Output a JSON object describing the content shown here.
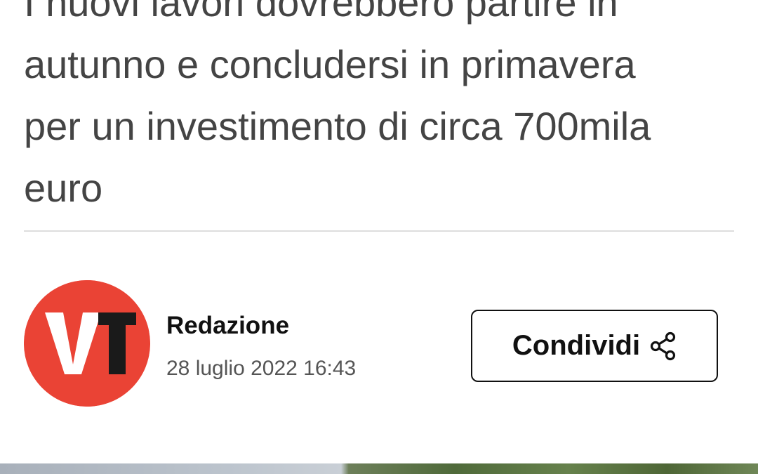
{
  "article": {
    "subtitle_lines": [
      "I nuovi lavori dovrebbero partire in",
      "autunno e concludersi in primavera",
      "per un investimento di circa 700mila",
      "euro"
    ]
  },
  "author": {
    "avatar_text": "VT",
    "avatar_color": "#ea4335",
    "name": "Redazione",
    "date": "28 luglio 2022 16:43"
  },
  "share": {
    "label": "Condividi",
    "icon": "share-icon"
  }
}
